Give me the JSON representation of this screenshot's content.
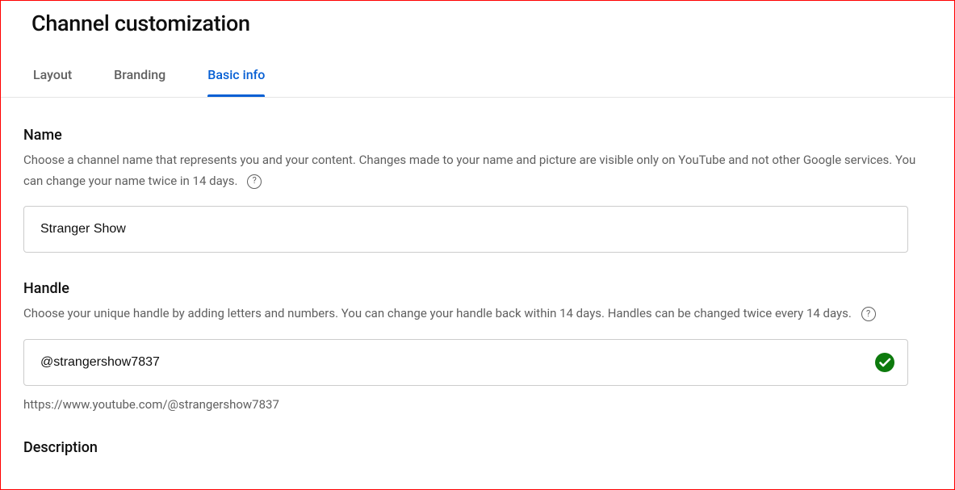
{
  "page": {
    "title": "Channel customization"
  },
  "tabs": {
    "layout": "Layout",
    "branding": "Branding",
    "basic_info": "Basic info"
  },
  "name_section": {
    "title": "Name",
    "help": "Choose a channel name that represents you and your content. Changes made to your name and picture are visible only on YouTube and not other Google services. You can change your name twice in 14 days.",
    "value": "Stranger Show"
  },
  "handle_section": {
    "title": "Handle",
    "help": "Choose your unique handle by adding letters and numbers. You can change your handle back within 14 days. Handles can be changed twice every 14 days.",
    "value": "@strangershow7837",
    "url": "https://www.youtube.com/@strangershow7837"
  },
  "description_section": {
    "title": "Description"
  }
}
